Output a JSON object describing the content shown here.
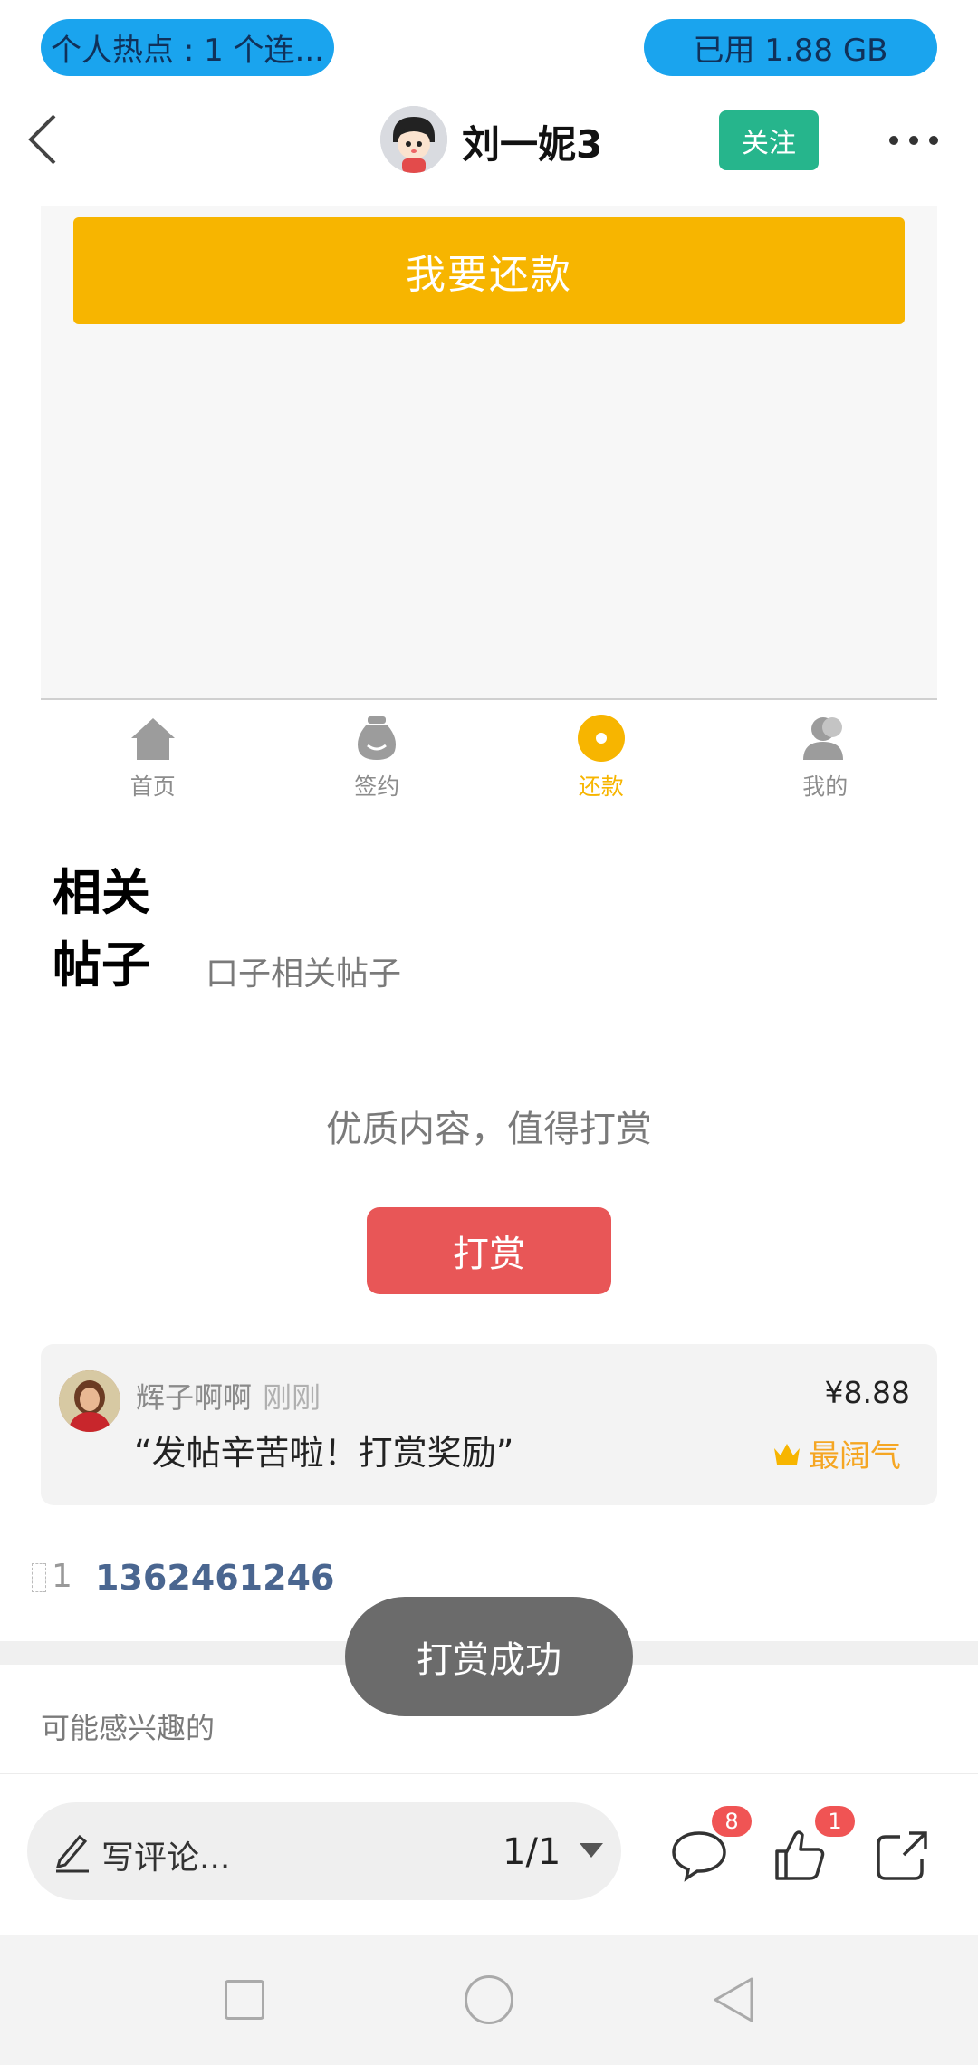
{
  "status_bar": {
    "hotspot": "个人热点 : 1 个连...",
    "data_used": "已用 1.88 GB"
  },
  "header": {
    "user_name": "刘一妮3",
    "follow_label": "关注"
  },
  "embed": {
    "repay_button": "我要还款",
    "nav": [
      {
        "label": "首页",
        "icon": "home-icon"
      },
      {
        "label": "签约",
        "icon": "bag-icon"
      },
      {
        "label": "还款",
        "icon": "coin-icon"
      },
      {
        "label": "我的",
        "icon": "person-icon"
      }
    ],
    "active_color": "#f7b500"
  },
  "related": {
    "title": "相关帖子",
    "subtitle": "口子相关帖子"
  },
  "reward": {
    "tip": "优质内容，值得打赏",
    "button": "打赏",
    "button_color": "#e85657",
    "record": {
      "user": "辉子啊啊",
      "time": "刚刚",
      "message": "“发帖辛苦啦！打赏奖励”",
      "amount": "¥8.88",
      "badge": "最阔气"
    }
  },
  "floor": {
    "label": "1",
    "phone": "1362461246"
  },
  "toast": "打赏成功",
  "interest_label": "可能感兴趣的",
  "bottom_bar": {
    "comment_placeholder": "写评论...",
    "page": "1/1",
    "comment_count": "8",
    "like_count": "1"
  }
}
